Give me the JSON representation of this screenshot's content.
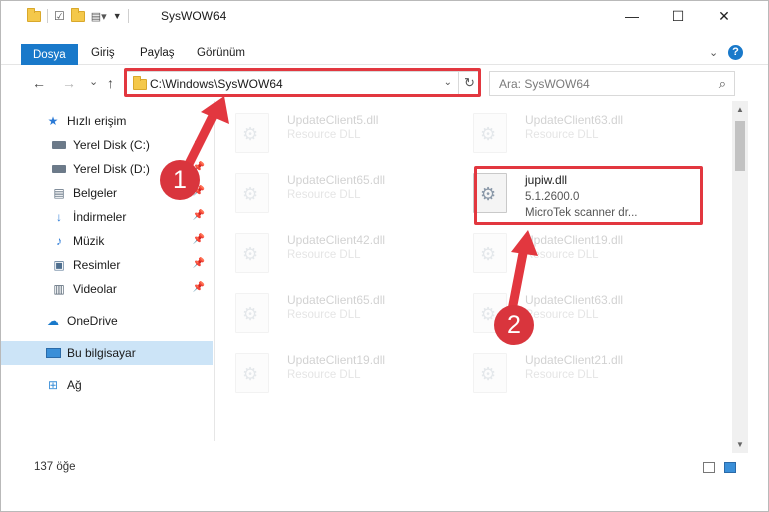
{
  "window": {
    "title": "SysWOW64",
    "minimize": "—",
    "maximize": "☐",
    "close": "✕"
  },
  "ribbon": {
    "tabs": [
      {
        "label": "Dosya",
        "active": true
      },
      {
        "label": "Giriş"
      },
      {
        "label": "Paylaş"
      },
      {
        "label": "Görünüm"
      }
    ],
    "expand_icon": "chevron-down-icon",
    "help_label": "?"
  },
  "nav": {
    "back": "←",
    "forward": "→",
    "recent": "⌄",
    "up": "↑"
  },
  "address": {
    "path": "C:\\Windows\\SysWOW64",
    "refresh": "↻"
  },
  "search": {
    "placeholder": "Ara: SysWOW64"
  },
  "sidebar": {
    "items": [
      {
        "label": "Hızlı erişim",
        "icon": "star-icon"
      },
      {
        "label": "Yerel Disk (C:)",
        "icon": "drive-icon",
        "pinned": true
      },
      {
        "label": "Yerel Disk (D:)",
        "icon": "drive-icon",
        "pinned": true
      },
      {
        "label": "Belgeler",
        "icon": "documents-icon",
        "pinned": true
      },
      {
        "label": "İndirmeler",
        "icon": "download-icon",
        "pinned": true
      },
      {
        "label": "Müzik",
        "icon": "music-icon",
        "pinned": true
      },
      {
        "label": "Resimler",
        "icon": "pictures-icon",
        "pinned": true
      },
      {
        "label": "Videolar",
        "icon": "videos-icon",
        "pinned": true
      },
      {
        "label": "OneDrive",
        "icon": "cloud-icon"
      },
      {
        "label": "Bu bilgisayar",
        "icon": "computer-icon",
        "selected": true
      },
      {
        "label": "Ağ",
        "icon": "network-icon"
      }
    ]
  },
  "files": [
    {
      "name": "UpdateClient5.dll",
      "desc": "Resource DLL",
      "faded": true
    },
    {
      "name": "UpdateClient63.dll",
      "desc": "Resource DLL",
      "faded": true
    },
    {
      "name": "UpdateClient65.dll",
      "desc": "Resource DLL",
      "faded": true
    },
    {
      "name": "jupiw.dll",
      "version": "5.1.2600.0",
      "desc": "MicroTek scanner dr...",
      "faded": false
    },
    {
      "name": "UpdateClient42.dll",
      "desc": "Resource DLL",
      "faded": true
    },
    {
      "name": "UpdateClient19.dll",
      "desc": "Resource DLL",
      "faded": true
    },
    {
      "name": "UpdateClient65.dll",
      "desc": "Resource DLL",
      "faded": true
    },
    {
      "name": "UpdateClient63.dll",
      "desc": "Resource DLL",
      "faded": true
    },
    {
      "name": "UpdateClient19.dll",
      "desc": "Resource DLL",
      "faded": true
    },
    {
      "name": "UpdateClient21.dll",
      "desc": "Resource DLL",
      "faded": true
    }
  ],
  "status": {
    "item_count": "137 öğe"
  },
  "annotations": {
    "step1": "1",
    "step2": "2",
    "color": "#e2373f"
  }
}
